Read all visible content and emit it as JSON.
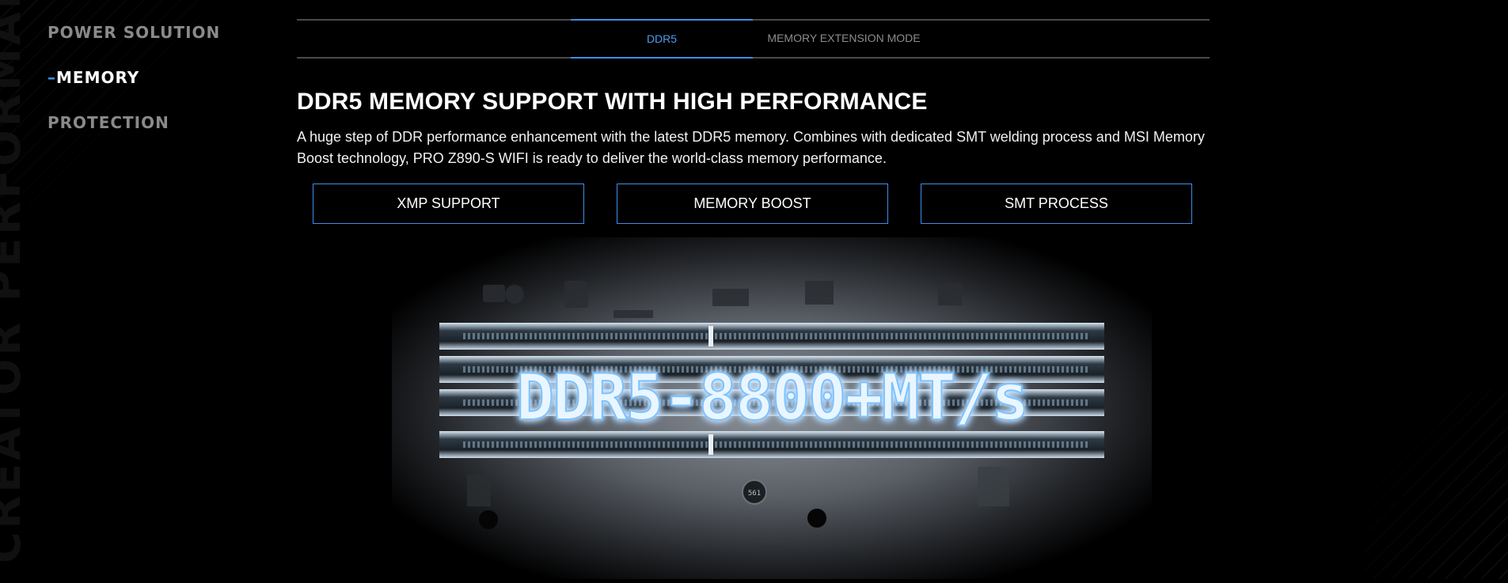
{
  "side_nav": {
    "items": [
      {
        "label": "POWER SOLUTION",
        "active": false
      },
      {
        "label": "MEMORY",
        "active": true
      },
      {
        "label": "PROTECTION",
        "active": false
      }
    ],
    "active_marker": "–"
  },
  "background_text": "CREATOR PERFORMANCE",
  "tabs": [
    {
      "label": "DDR5",
      "active": true
    },
    {
      "label": "MEMORY EXTENSION MODE",
      "active": false
    }
  ],
  "section": {
    "title": "DDR5 MEMORY SUPPORT WITH HIGH PERFORMANCE",
    "description": "A huge step of DDR performance enhancement with the latest DDR5 memory. Combines with dedicated SMT welding process and MSI Memory Boost technology, PRO Z890-S WIFI is ready to deliver the world-class memory performance."
  },
  "feature_buttons": [
    {
      "label": "XMP SUPPORT"
    },
    {
      "label": "MEMORY BOOST"
    },
    {
      "label": "SMT PROCESS"
    }
  ],
  "hero": {
    "headline": "DDR5-8800+MT/s",
    "chip_label": "561"
  },
  "colors": {
    "accent": "#3d8ee8",
    "background": "#000000",
    "inactive_text": "#8a8a8a"
  }
}
